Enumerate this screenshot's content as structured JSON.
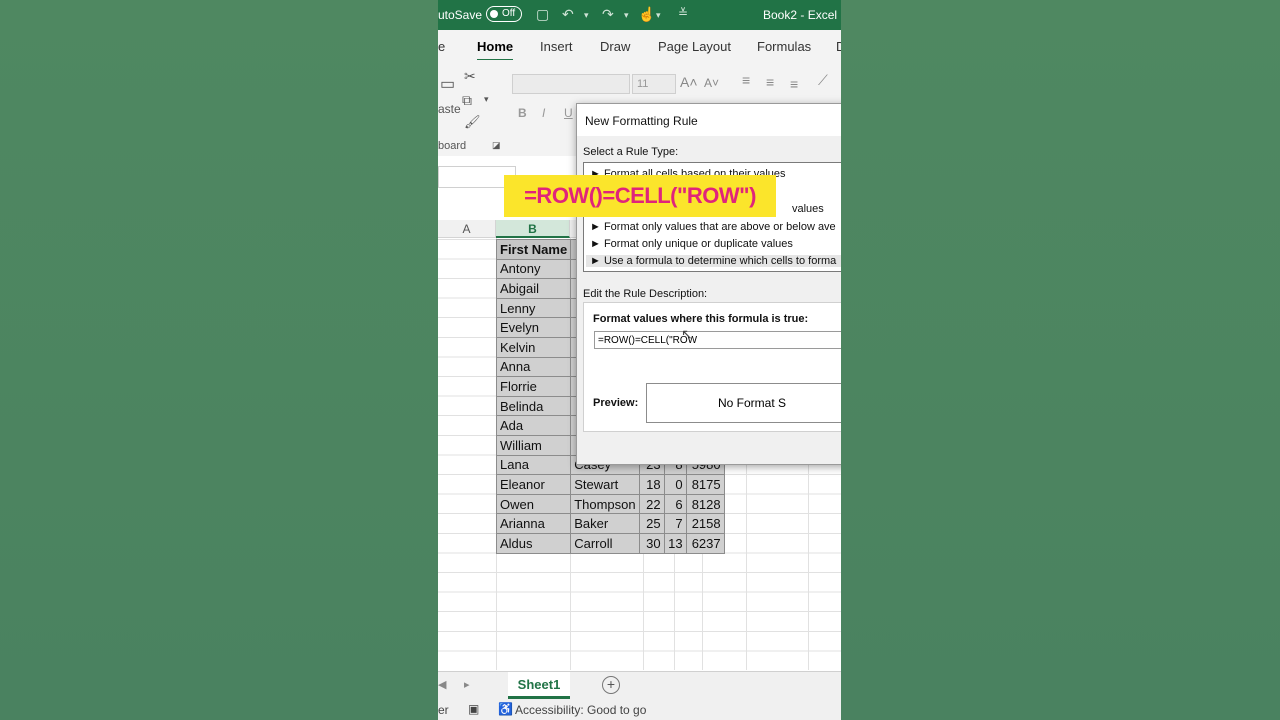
{
  "titlebar": {
    "autosave": "utoSave",
    "toggle": "Off",
    "document": "Book2  -  Excel"
  },
  "tabs": [
    {
      "label": "e"
    },
    {
      "label": "Home"
    },
    {
      "label": "Insert"
    },
    {
      "label": "Draw"
    },
    {
      "label": "Page Layout"
    },
    {
      "label": "Formulas"
    },
    {
      "label": "D"
    }
  ],
  "ribbon": {
    "paste_label": "aste",
    "clipboard_label": "board",
    "font_size": "11",
    "bold": "B",
    "italic": "I",
    "underline": "U"
  },
  "columns": {
    "a": "A",
    "b": "B"
  },
  "callout": "=ROW()=CELL(\"ROW\")",
  "table": {
    "headers": [
      "First Name",
      "",
      "",
      "",
      ""
    ],
    "rows": [
      [
        "Antony",
        "",
        "",
        "",
        ""
      ],
      [
        "Abigail",
        "",
        "",
        "",
        ""
      ],
      [
        "Lenny",
        "",
        "",
        "",
        ""
      ],
      [
        "Evelyn",
        "",
        "",
        "",
        ""
      ],
      [
        "Kelvin",
        "",
        "",
        "",
        ""
      ],
      [
        "Anna",
        "",
        "",
        "",
        ""
      ],
      [
        "Florrie",
        "",
        "",
        "",
        ""
      ],
      [
        "Belinda",
        "",
        "",
        "",
        ""
      ],
      [
        "Ada",
        "",
        "",
        "",
        ""
      ],
      [
        "William",
        "",
        "",
        "",
        ""
      ],
      [
        "Lana",
        "Casey",
        "23",
        "8",
        "5980"
      ],
      [
        "Eleanor",
        "Stewart",
        "18",
        "0",
        "8175"
      ],
      [
        "Owen",
        "Thompson",
        "22",
        "6",
        "8128"
      ],
      [
        "Arianna",
        "Baker",
        "25",
        "7",
        "2158"
      ],
      [
        "Aldus",
        "Carroll",
        "30",
        "13",
        "6237"
      ]
    ]
  },
  "dialog": {
    "title": "New Formatting Rule",
    "select_rule_type": "Select a Rule Type:",
    "rules": [
      "► Format all cells based on their values",
      "",
      "values",
      "► Format only values that are above or below ave",
      "► Format only unique or duplicate values",
      "► Use a formula to determine which cells to forma"
    ],
    "edit_description": "Edit the Rule Description:",
    "format_values_label": "Format values where this formula is true:",
    "formula": "=ROW()=CELL(\"ROW",
    "preview_label": "Preview:",
    "preview_text": "No Format S"
  },
  "sheet": {
    "tab": "Sheet1",
    "add": "+"
  },
  "status": {
    "left": "er",
    "accessibility": "Accessibility: Good to go"
  }
}
